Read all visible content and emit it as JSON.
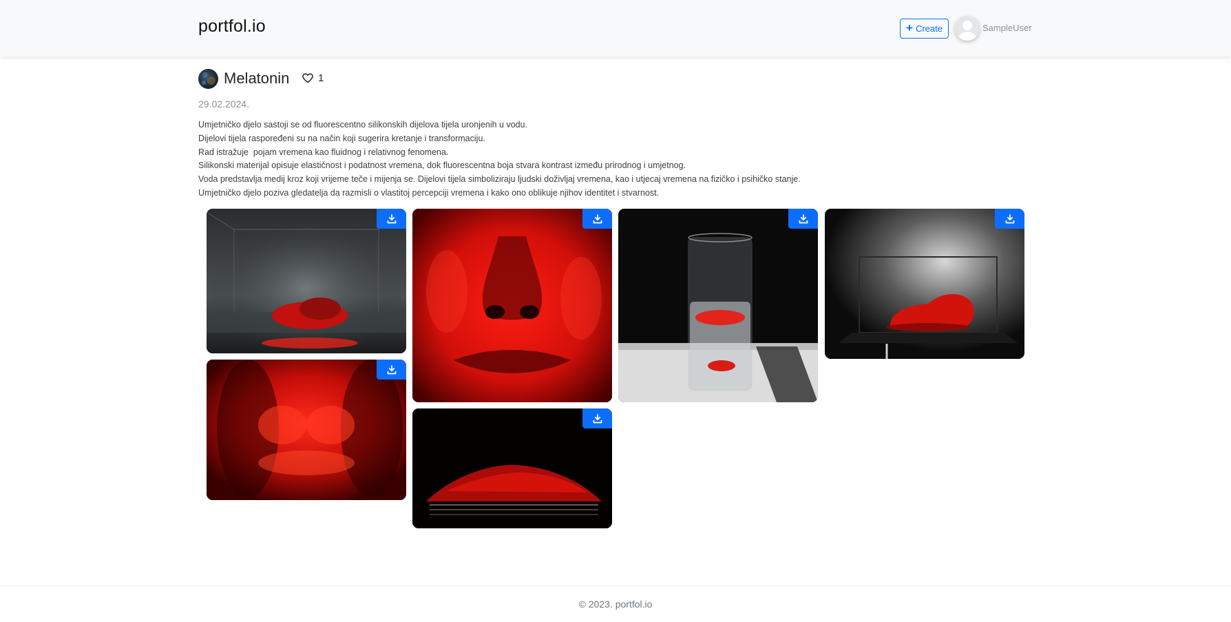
{
  "header": {
    "brand": "portfol.io",
    "create_label": "Create",
    "username": "SampleUser"
  },
  "artwork": {
    "title": "Melatonin",
    "likes": "1",
    "date": "29.02.2024.",
    "description": [
      "Umjetničko djelo sastoji se od fluorescentno silikonskih dijelova tijela uronjenih u vodu.",
      "Dijelovi tijela raspoređeni su na način koji sugerira kretanje i transformaciju.",
      "Rad istražuje  pojam vremena kao fluidnog i relativnog fenomena.",
      "Silikonski materijal opisuje elastičnost i podatnost vremena, dok fluorescentna boja stvara kontrast između prirodnog i umjetnog.",
      "Voda predstavlja medij kroz koji vrijeme teče i mijenja se. Dijelovi tijela simboliziraju ljudski doživljaj vremena, kao i utjecaj vremena na fizičko i psihičko stanje.",
      "Umjetničko djelo poziva gledatelja da razmisli o vlastitoj percepciji vremena i kako ono oblikuje njihov identitet i stvarnost."
    ]
  },
  "gallery": {
    "download_icon": "download-icon",
    "images": [
      {
        "name": "photo-head-in-glass-tank"
      },
      {
        "name": "photo-red-torso"
      },
      {
        "name": "photo-red-face-closeup"
      },
      {
        "name": "photo-red-shape-layers"
      },
      {
        "name": "photo-glass-of-water"
      },
      {
        "name": "photo-red-form-in-display-case"
      }
    ]
  },
  "footer": {
    "text": "© 2023. portfol.io"
  },
  "colors": {
    "accent": "#0d6efd",
    "header_bg": "#f8f9fa",
    "muted": "#8a8f94"
  }
}
